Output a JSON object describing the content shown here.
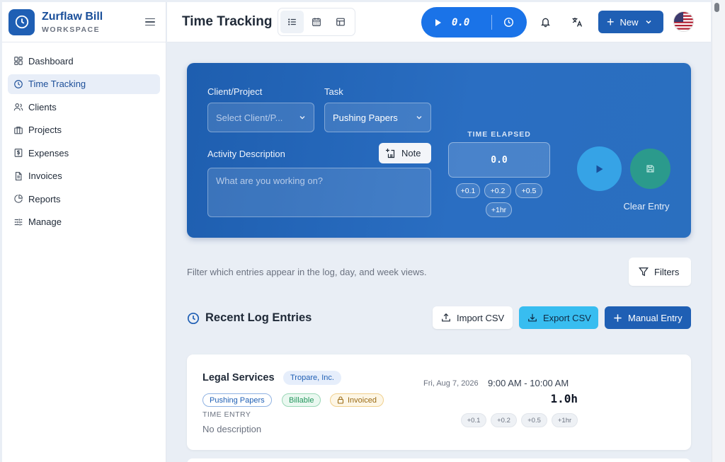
{
  "brand": {
    "name": "Zurflaw Bill",
    "subtitle": "WORKSPACE"
  },
  "sidebar": {
    "items": [
      {
        "label": "Dashboard",
        "icon": "dashboard-icon",
        "active": false
      },
      {
        "label": "Time Tracking",
        "icon": "clock-icon",
        "active": true
      },
      {
        "label": "Clients",
        "icon": "users-icon",
        "active": false
      },
      {
        "label": "Projects",
        "icon": "briefcase-icon",
        "active": false
      },
      {
        "label": "Expenses",
        "icon": "dollar-receipt-icon",
        "active": false
      },
      {
        "label": "Invoices",
        "icon": "document-icon",
        "active": false
      },
      {
        "label": "Reports",
        "icon": "pie-chart-icon",
        "active": false
      },
      {
        "label": "Manage",
        "icon": "sliders-icon",
        "active": false
      }
    ]
  },
  "header": {
    "title": "Time Tracking",
    "views": [
      "list-view-icon",
      "calendar-view-icon",
      "table-view-icon"
    ],
    "timer_value": "0.0",
    "new_label": "New"
  },
  "timer_card": {
    "client_label": "Client/Project",
    "client_placeholder": "Select Client/P...",
    "task_label": "Task",
    "task_value": "Pushing Papers",
    "activity_label": "Activity Description",
    "note_label": "Note",
    "activity_placeholder": "What are you working on?",
    "elapsed_label": "TIME ELAPSED",
    "elapsed_value": "0.0",
    "increments": [
      "+0.1",
      "+0.2",
      "+0.5",
      "+1hr"
    ],
    "clear_label": "Clear Entry"
  },
  "filters": {
    "hint": "Filter which entries appear in the log, day, and week views.",
    "button_label": "Filters"
  },
  "log": {
    "title": "Recent Log Entries",
    "import_label": "Import CSV",
    "export_label": "Export CSV",
    "manual_label": "Manual Entry"
  },
  "entries": [
    {
      "title": "Legal Services",
      "client": "Tropare, Inc.",
      "task": "Pushing Papers",
      "billable": "Billable",
      "invoiced": "Invoiced",
      "type": "TIME ENTRY",
      "description": "No description",
      "date": "Fri, Aug 7, 2026",
      "time_range": "9:00 AM - 10:00 AM",
      "hours": "1.0h",
      "increments": [
        "+0.1",
        "+0.2",
        "+0.5",
        "+1hr"
      ]
    }
  ],
  "colors": {
    "primary": "#1f5fb4",
    "timer_blue": "#1a73e8",
    "play_cyan": "#36a3e6",
    "save_teal": "#2b9a8c",
    "export_cyan": "#38bdf0"
  }
}
